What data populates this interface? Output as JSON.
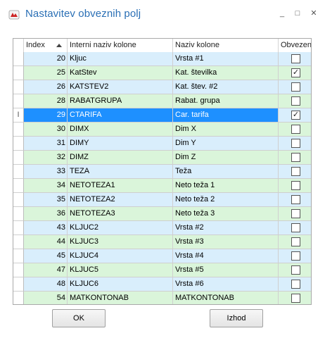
{
  "window": {
    "title": "Nastavitev obveznih polj",
    "icon": "app-logo-icon",
    "minimize_glyph": "_",
    "maximize_glyph": "□",
    "close_glyph": "✕"
  },
  "grid": {
    "columns": [
      "Index",
      "Interni naziv kolone",
      "Naziv kolone",
      "Obvezen"
    ],
    "sort": {
      "column": "Index",
      "direction": "ascending"
    },
    "row_indicator": "I",
    "rows": [
      {
        "index": "20",
        "interni": "Kljuc",
        "naziv": "Vrsta #1",
        "obvezen": false,
        "selected": false
      },
      {
        "index": "25",
        "interni": "KatStev",
        "naziv": "Kat. številka",
        "obvezen": true,
        "selected": false
      },
      {
        "index": "26",
        "interni": "KATSTEV2",
        "naziv": "Kat. štev. #2",
        "obvezen": false,
        "selected": false
      },
      {
        "index": "28",
        "interni": "RABATGRUPA",
        "naziv": "Rabat. grupa",
        "obvezen": false,
        "selected": false
      },
      {
        "index": "29",
        "interni": "CTARIFA",
        "naziv": "Car. tarifa",
        "obvezen": true,
        "selected": true
      },
      {
        "index": "30",
        "interni": "DIMX",
        "naziv": "Dim X",
        "obvezen": false,
        "selected": false
      },
      {
        "index": "31",
        "interni": "DIMY",
        "naziv": "Dim Y",
        "obvezen": false,
        "selected": false
      },
      {
        "index": "32",
        "interni": "DIMZ",
        "naziv": "Dim Z",
        "obvezen": false,
        "selected": false
      },
      {
        "index": "33",
        "interni": "TEZA",
        "naziv": "Teža",
        "obvezen": false,
        "selected": false
      },
      {
        "index": "34",
        "interni": "NETOTEZA1",
        "naziv": "Neto teža 1",
        "obvezen": false,
        "selected": false
      },
      {
        "index": "35",
        "interni": "NETOTEZA2",
        "naziv": "Neto teža 2",
        "obvezen": false,
        "selected": false
      },
      {
        "index": "36",
        "interni": "NETOTEZA3",
        "naziv": "Neto teža 3",
        "obvezen": false,
        "selected": false
      },
      {
        "index": "43",
        "interni": "KLJUC2",
        "naziv": "Vrsta #2",
        "obvezen": false,
        "selected": false
      },
      {
        "index": "44",
        "interni": "KLJUC3",
        "naziv": "Vrsta #3",
        "obvezen": false,
        "selected": false
      },
      {
        "index": "45",
        "interni": "KLJUC4",
        "naziv": "Vrsta #4",
        "obvezen": false,
        "selected": false
      },
      {
        "index": "47",
        "interni": "KLJUC5",
        "naziv": "Vrsta #5",
        "obvezen": false,
        "selected": false
      },
      {
        "index": "48",
        "interni": "KLJUC6",
        "naziv": "Vrsta #6",
        "obvezen": false,
        "selected": false
      },
      {
        "index": "54",
        "interni": "MATKONTONAB",
        "naziv": "MATKONTONAB",
        "obvezen": false,
        "selected": false
      }
    ]
  },
  "buttons": {
    "ok": "OK",
    "izhod": "Izhod"
  },
  "colors": {
    "title": "#2a6fb5",
    "row_even": "#daf5da",
    "row_odd": "#d9eefc",
    "selected": "#1e90ff"
  }
}
